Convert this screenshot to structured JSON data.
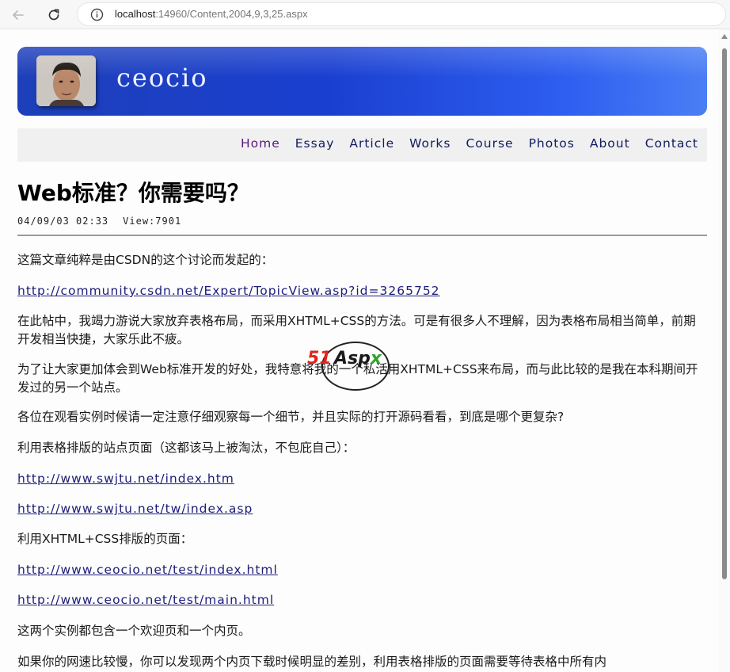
{
  "browser": {
    "url_host": "localhost",
    "url_rest": ":14960/Content,2004,9,3,25.aspx"
  },
  "site": {
    "name": "ceocio"
  },
  "nav": {
    "items": [
      "Home",
      "Essay",
      "Article",
      "Works",
      "Course",
      "Photos",
      "About",
      "Contact"
    ],
    "active": "Home"
  },
  "article": {
    "title": "Web标准？你需要吗？",
    "date": "04/09/03 02:33",
    "views": "View:7901",
    "p1": "这篇文章纯粹是由CSDN的这个讨论而发起的：",
    "link1": "http://community.csdn.net/Expert/TopicView.asp?id=3265752",
    "p2": "在此帖中，我竭力游说大家放弃表格布局，而采用XHTML+CSS的方法。可是有很多人不理解，因为表格布局相当简单，前期开发相当快捷，大家乐此不疲。",
    "p3": "为了让大家更加体会到Web标准开发的好处，我特意将我的一个私活用XHTML+CSS来布局，而与此比较的是我在本科期间开发过的另一个站点。",
    "p4": "各位在观看实例时候请一定注意仔细观察每一个细节，并且实际的打开源码看看，到底是哪个更复杂?",
    "p5": "利用表格排版的站点页面（这都该马上被淘汰，不包庇自己）：",
    "link2": "http://www.swjtu.net/index.htm",
    "link3": "http://www.swjtu.net/tw/index.asp",
    "p6": "利用XHTML+CSS排版的页面：",
    "link4": "http://www.ceocio.net/test/index.html",
    "link5": "http://www.ceocio.net/test/main.html",
    "p7": "这两个实例都包含一个欢迎页和一个内页。",
    "p8": "如果你的网速比较慢，你可以发现两个内页下载时候明显的差别，利用表格排版的页面需要等待表格中所有内"
  },
  "watermark": {
    "part1": "51",
    "part2": "Asp",
    "part3": "x"
  }
}
